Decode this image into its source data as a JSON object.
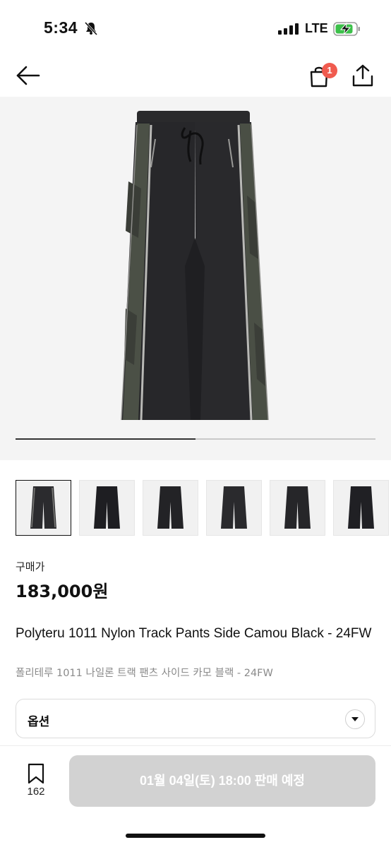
{
  "status_bar": {
    "time": "5:34",
    "network": "LTE"
  },
  "nav": {
    "cart_count": "1"
  },
  "gallery": {
    "progress_fraction": 0.5,
    "thumbnail_count": 6,
    "active_thumbnail": 0
  },
  "price": {
    "label": "구매가",
    "value": "183,000원"
  },
  "product": {
    "title_en": "Polyteru 1011 Nylon Track Pants Side Camou Black - 24FW",
    "title_ko": "폴리테루 1011 나일론 트랙 팬츠 사이드 카모 블랙 - 24FW"
  },
  "option": {
    "label": "옵션"
  },
  "bottom": {
    "bookmark_count": "162",
    "sale_button_label": "01월 04일(토) 18:00 판매 예정"
  },
  "colors": {
    "accent_badge": "#f05b4f",
    "disabled_button": "#d2d2d2",
    "hero_bg": "#f4f4f4"
  }
}
